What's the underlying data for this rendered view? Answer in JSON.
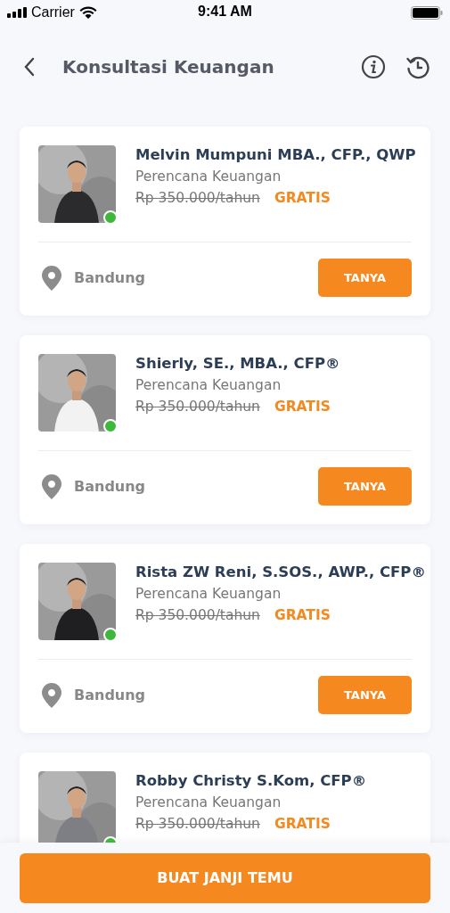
{
  "status_bar": {
    "carrier": "Carrier",
    "time": "9:41 AM"
  },
  "header": {
    "title": "Konsultasi Keuangan"
  },
  "advisors": [
    {
      "name": "Melvin Mumpuni MBA., CFP., QWP",
      "role": "Perencana Keuangan",
      "old_price": "Rp 350.000/tahun",
      "price": "GRATIS",
      "online": true,
      "location": "Bandung",
      "action": "TANYA"
    },
    {
      "name": "Shierly, SE., MBA., CFP®",
      "role": "Perencana Keuangan",
      "old_price": "Rp 350.000/tahun",
      "price": "GRATIS",
      "online": true,
      "location": "Bandung",
      "action": "TANYA"
    },
    {
      "name": "Rista ZW Reni, S.SOS., AWP., CFP®",
      "role": "Perencana Keuangan",
      "old_price": "Rp 350.000/tahun",
      "price": "GRATIS",
      "online": true,
      "location": "Bandung",
      "action": "TANYA"
    },
    {
      "name": "Robby Christy S.Kom, CFP®",
      "role": "Perencana Keuangan",
      "old_price": "Rp 350.000/tahun",
      "price": "GRATIS",
      "online": true
    }
  ],
  "primary_button": "BUAT JANJI TEMU"
}
